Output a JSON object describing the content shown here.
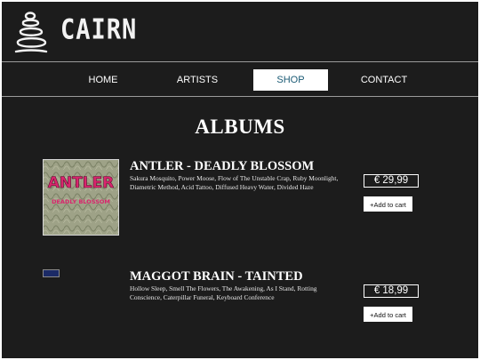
{
  "brand": {
    "name": "CAIRN",
    "logo_icon": "stacked-stones-icon"
  },
  "nav": {
    "items": [
      {
        "label": "HOME",
        "active": false
      },
      {
        "label": "ARTISTS",
        "active": false
      },
      {
        "label": "SHOP",
        "active": true
      },
      {
        "label": "CONTACT",
        "active": false
      }
    ]
  },
  "page": {
    "title": "ALBUMS"
  },
  "albums": [
    {
      "name": "ANTLER - DEADLY BLOSSOM",
      "tracks": "Sakura Mosquito, Power Moose, Flow of The Unstable Crap, Ruby Moonlight, Diametric Method, Acid Tattoo, Diffused Heavy Water, Divided Haze",
      "price": "€ 29,99",
      "cart_label": "+Add to cart",
      "cover_text": "ANTLER",
      "cover_subtext": "DEADLY BLOSSOM",
      "cover_colors": {
        "bg": "#9ea287",
        "text": "#d9256d"
      }
    },
    {
      "name": "MAGGOT BRAIN - TAINTED",
      "tracks": "Hollow Sleep, Smell The Flowers, The Awakening, As I Stand, Rotting Conscience, Caterpillar Funeral, Keyboard Conference",
      "price": "€ 18,99",
      "cart_label": "+Add to cart",
      "cover_broken": true
    }
  ],
  "colors": {
    "background": "#1c1c1c",
    "active_nav_text": "#1a5a74",
    "divider": "#9a9a9a"
  }
}
